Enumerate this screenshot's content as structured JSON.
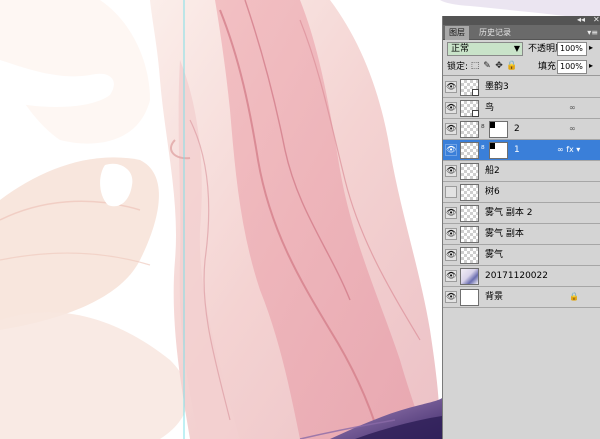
{
  "panel": {
    "topbar": {
      "collapse": "◂◂",
      "close": "✕"
    },
    "tabs": [
      {
        "label": "图层",
        "active": true
      },
      {
        "label": "历史记录",
        "active": false
      }
    ],
    "tab_menu": "▾≡",
    "blend_mode": "正常",
    "opacity_label": "不透明度:",
    "opacity_value": "100%",
    "lock_label": "锁定:",
    "fill_label": "填充:",
    "fill_value": "100%",
    "selection_color": "#3a7fd9"
  },
  "layers": [
    {
      "name": "墨韵3",
      "visible": true,
      "thumb": "transparent",
      "badge": true,
      "chain": false,
      "mask": false,
      "right": ""
    },
    {
      "name": "鸟",
      "visible": true,
      "thumb": "transparent",
      "badge": true,
      "chain": false,
      "mask": false,
      "right": "link-icon"
    },
    {
      "name": "2",
      "visible": true,
      "thumb": "transparent",
      "badge": false,
      "chain": true,
      "mask": true,
      "right": "link-icon"
    },
    {
      "name": "1",
      "visible": true,
      "thumb": "transparent",
      "badge": false,
      "chain": true,
      "mask": true,
      "right": "fx-icon",
      "selected": true
    },
    {
      "name": "船2",
      "visible": true,
      "thumb": "transparent",
      "badge": false,
      "chain": false,
      "mask": false,
      "right": ""
    },
    {
      "name": "树6",
      "visible": false,
      "thumb": "transparent",
      "badge": false,
      "chain": false,
      "mask": false,
      "right": ""
    },
    {
      "name": "雾气 副本 2",
      "visible": true,
      "thumb": "transparent",
      "badge": false,
      "chain": false,
      "mask": false,
      "right": ""
    },
    {
      "name": "雾气 副本",
      "visible": true,
      "thumb": "transparent",
      "badge": false,
      "chain": false,
      "mask": false,
      "right": ""
    },
    {
      "name": "雾气",
      "visible": true,
      "thumb": "transparent",
      "badge": false,
      "chain": false,
      "mask": false,
      "right": ""
    },
    {
      "name": "20171120022",
      "visible": true,
      "thumb": "photo",
      "badge": false,
      "chain": false,
      "mask": false,
      "right": ""
    },
    {
      "name": "背景",
      "visible": true,
      "thumb": "white",
      "badge": false,
      "chain": false,
      "mask": false,
      "right": "lock-icon"
    }
  ],
  "colors": {
    "wash_light": "#f6dcd9",
    "wash_mid": "#eeb3b8",
    "wash_line": "#d98a93",
    "ink_purple": "#5b3d7a",
    "guide": "#7fe0e8"
  }
}
